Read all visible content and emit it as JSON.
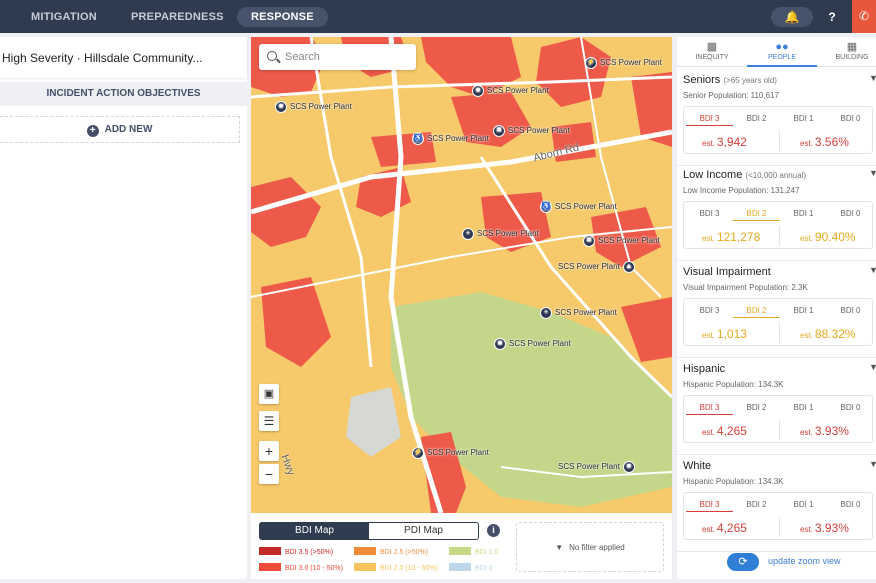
{
  "topbar": {
    "tabs": [
      {
        "label": "MITIGATION",
        "active": false
      },
      {
        "label": "PREPAREDNESS",
        "active": false
      },
      {
        "label": "RESPONSE",
        "active": true
      }
    ],
    "icons": [
      "bell-icon",
      "help-icon",
      "phone-icon"
    ]
  },
  "incident": {
    "title": "High Severity · Hillsdale Community...",
    "objectives_header": "INCIDENT ACTION OBJECTIVES",
    "add_new": "ADD NEW"
  },
  "map": {
    "search_placeholder": "Search",
    "street_label": "Aborn Rd",
    "hwy_label": "Hwy",
    "poi_label": "SCS Power Plant",
    "pois": [
      {
        "icon": "power-icon",
        "label": "SCS Power Plant"
      },
      {
        "icon": "school-icon",
        "label": "SCS Power Plant"
      },
      {
        "icon": "school-icon",
        "label": "SCS Power Plant"
      },
      {
        "icon": "pharmacy-icon",
        "label": "SCS Power Plant"
      },
      {
        "icon": "accessibility-icon",
        "label": "SCS Power Plant"
      },
      {
        "icon": "accessibility-icon",
        "label": "SCS Power Plant"
      },
      {
        "icon": "hospital-icon",
        "label": "SCS Power Plant"
      },
      {
        "icon": "pharmacy-icon",
        "label": "SCS Power Plant"
      },
      {
        "icon": "shield-icon",
        "label": "SCS Power Plant"
      },
      {
        "icon": "hospital-icon",
        "label": "SCS Power Plant"
      },
      {
        "icon": "school-icon",
        "label": "SCS Power Plant"
      },
      {
        "icon": "power-icon",
        "label": "SCS Power Plant"
      },
      {
        "icon": "school-icon",
        "label": "SCS Power Plant"
      }
    ],
    "controls": [
      "add-layer-icon",
      "layers-icon",
      "+",
      "−"
    ]
  },
  "legend": {
    "toggle": [
      "BDI Map",
      "PDI Map"
    ],
    "active_toggle": "BDI Map",
    "items": [
      {
        "label": "BDI 3.5 (>50%)",
        "color": "#c42a2a"
      },
      {
        "label": "BDI 2.5 (>50%)",
        "color": "#f28c3c"
      },
      {
        "label": "BDI 1.0",
        "color": "#c9d98a"
      },
      {
        "label": "BDI 3.0 (10 - 50%)",
        "color": "#ee4b3b"
      },
      {
        "label": "BDI 2.0 (10 - 50%)",
        "color": "#f6c45c"
      },
      {
        "label": "BDI 0",
        "color": "#bcd8ea"
      }
    ],
    "filter_text": "No filter applied"
  },
  "right": {
    "tabs": [
      {
        "label": "INEQUITY",
        "icon": "bar-chart-icon",
        "active": false
      },
      {
        "label": "PEOPLE",
        "icon": "people-icon",
        "active": true
      },
      {
        "label": "BUILDING",
        "icon": "building-icon",
        "active": false
      }
    ],
    "bdi_labels": [
      "BDI 3",
      "BDI 2",
      "BDI 1",
      "BDI 0"
    ],
    "est_prefix": "est.",
    "cards": [
      {
        "name": "Seniors",
        "qualifier": "(>65 years old)",
        "sub": "Senior Population: 110,617",
        "active_bdi": 3,
        "est_value": "3,942",
        "est_pct": "3.56%"
      },
      {
        "name": "Low Income",
        "qualifier": "(<10,000 annual)",
        "sub": "Low Income Population: 131,247",
        "active_bdi": 2,
        "est_value": "121,278",
        "est_pct": "90.40%"
      },
      {
        "name": "Visual Impairment",
        "qualifier": "",
        "sub": "Visual Impairment Population: 2.3K",
        "active_bdi": 2,
        "est_value": "1,013",
        "est_pct": "88.32%"
      },
      {
        "name": "Hispanic",
        "qualifier": "",
        "sub": "Hispanic Population: 134.3K",
        "active_bdi": 3,
        "est_value": "4,265",
        "est_pct": "3.93%"
      },
      {
        "name": "White",
        "qualifier": "",
        "sub": "Hispanic Population: 134.3K",
        "active_bdi": 3,
        "est_value": "4,265",
        "est_pct": "3.93%"
      }
    ],
    "update_label": "update zoom view"
  }
}
